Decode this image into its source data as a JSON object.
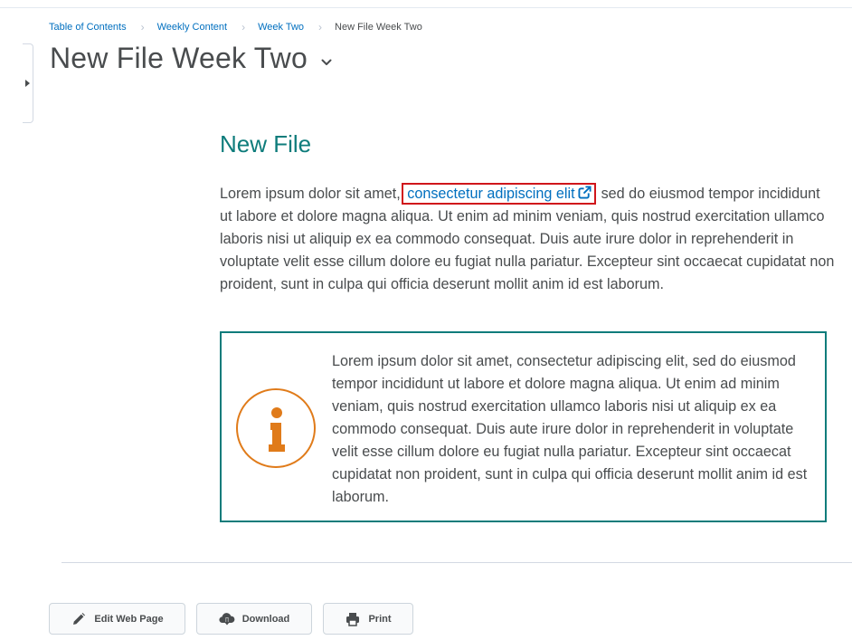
{
  "breadcrumb": {
    "items": [
      "Table of Contents",
      "Weekly Content",
      "Week Two"
    ],
    "current": "New File Week Two"
  },
  "page": {
    "title": "New File Week Two"
  },
  "content": {
    "heading": "New File",
    "para_before": "Lorem ipsum dolor sit amet,",
    "link_text": "consectetur adipiscing elit",
    "para_after": ", sed do eiusmod tempor incididunt ut labore et dolore magna aliqua. Ut enim ad minim veniam, quis nostrud exercitation ullamco laboris nisi ut aliquip ex ea commodo consequat. Duis aute irure dolor in reprehenderit in voluptate velit esse cillum dolore eu fugiat nulla pariatur. Excepteur sint occaecat cupidatat non proident, sunt in culpa qui officia deserunt mollit anim id est laborum.",
    "info_text": "Lorem ipsum dolor sit amet, consectetur adipiscing elit, sed do eiusmod tempor incididunt ut labore et dolore magna aliqua. Ut enim ad minim veniam, quis nostrud exercitation ullamco laboris nisi ut aliquip ex ea commodo consequat. Duis aute irure dolor in reprehenderit in voluptate velit esse cillum dolore eu fugiat nulla pariatur. Excepteur sint occaecat cupidatat non proident, sunt in culpa qui officia deserunt mollit anim id est laborum."
  },
  "actions": {
    "edit_label": "Edit Web Page",
    "download_label": "Download",
    "print_label": "Print"
  },
  "icons": {
    "title_dropdown": "chevron-down-icon",
    "sidebar_toggle": "chevron-right-icon",
    "external_link": "external-link-icon",
    "info": "info-icon",
    "edit": "pencil-icon",
    "download": "cloud-download-icon",
    "print": "printer-icon"
  },
  "colors": {
    "accent_teal": "#0e7c7b",
    "link_blue": "#006fbf",
    "info_orange": "#e07b1a",
    "highlight_red": "#d0161b",
    "text": "#494c4e"
  }
}
